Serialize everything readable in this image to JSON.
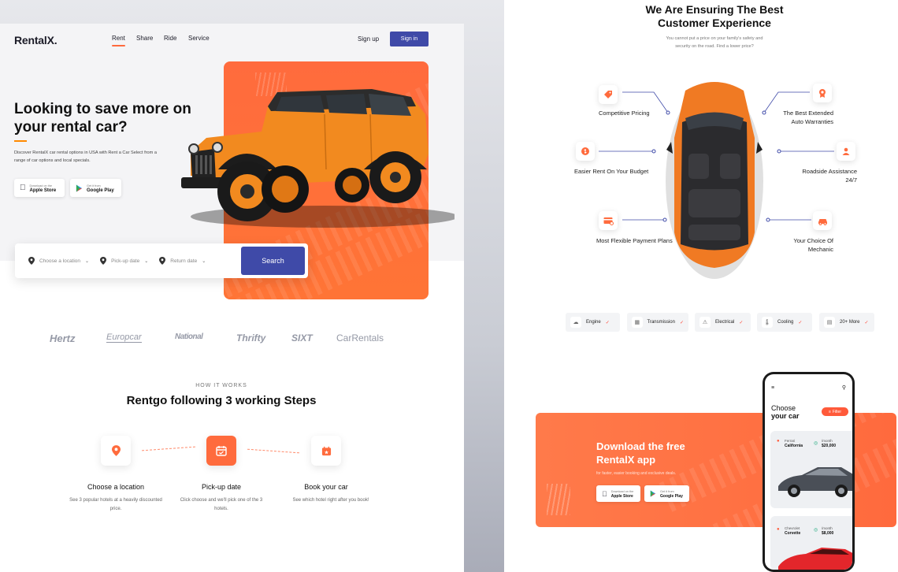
{
  "left": {
    "nav": {
      "logo": "RentalX.",
      "links": [
        "Rent",
        "Share",
        "Ride",
        "Service"
      ],
      "signup": "Sign up",
      "signin": "Sign in"
    },
    "hero": {
      "title": "Looking to save more on your rental car?",
      "subtitle": "Discover RentalX car rental options in USA with  Rent a Car Select from a range of car options and local specials.",
      "apple_small": "Download on the",
      "apple_big": "Apple Store",
      "google_small": "Get it from",
      "google_big": "Google Play"
    },
    "search": {
      "location": "Choose a location",
      "pickup": "Pick-up date",
      "return": "Return date",
      "button": "Search"
    },
    "brands": [
      "Hertz",
      "Europcar",
      "National",
      "Thrifty",
      "SIXT",
      "CarRentals"
    ],
    "how": {
      "eyebrow": "HOW IT WORKS",
      "title": "Rentgo following 3 working Steps",
      "steps": [
        {
          "title": "Choose a location",
          "desc": "See 3 popular hotels at a heavily discounted price."
        },
        {
          "title": "Pick-up date",
          "desc": "Click choose and we'll pick one of the 3 hotels."
        },
        {
          "title": "Book your car",
          "desc": "See which hotel right after you book!"
        }
      ]
    }
  },
  "right": {
    "title": "We Are Ensuring The Best Customer Experience",
    "subtitle": "You cannot put a price on your family's safety and security on the road. Find a lower price?",
    "features": [
      "Competitive Pricing",
      "The Best Extended Auto Warranties",
      "Easier Rent On Your Budget",
      "Roadside Assistance 24/7",
      "Most Flexible Payment Plans",
      "Your Choice Of Mechanic"
    ],
    "chips": [
      "Engine",
      "Transmission",
      "Electrical",
      "Cooling",
      "20+ More"
    ],
    "download": {
      "title": "Download the free RentalX app",
      "subtitle": "for faster, easier booking and exclusive deals.",
      "apple_small": "Download on the",
      "apple_big": "Apple Store",
      "google_small": "Get it from",
      "google_big": "Google Play"
    },
    "phone": {
      "title_line1": "Choose",
      "title_line2": "your car",
      "filter": "Filter",
      "cars": [
        {
          "make": "Ferrari",
          "model": "California",
          "price_label": "/month",
          "price": "$20,000"
        },
        {
          "make": "Chevrolet",
          "model": "Corvette",
          "price_label": "/month",
          "price": "$8,000"
        }
      ]
    }
  },
  "colors": {
    "accent": "#ff6b3d",
    "primary": "#3f4aa8"
  }
}
